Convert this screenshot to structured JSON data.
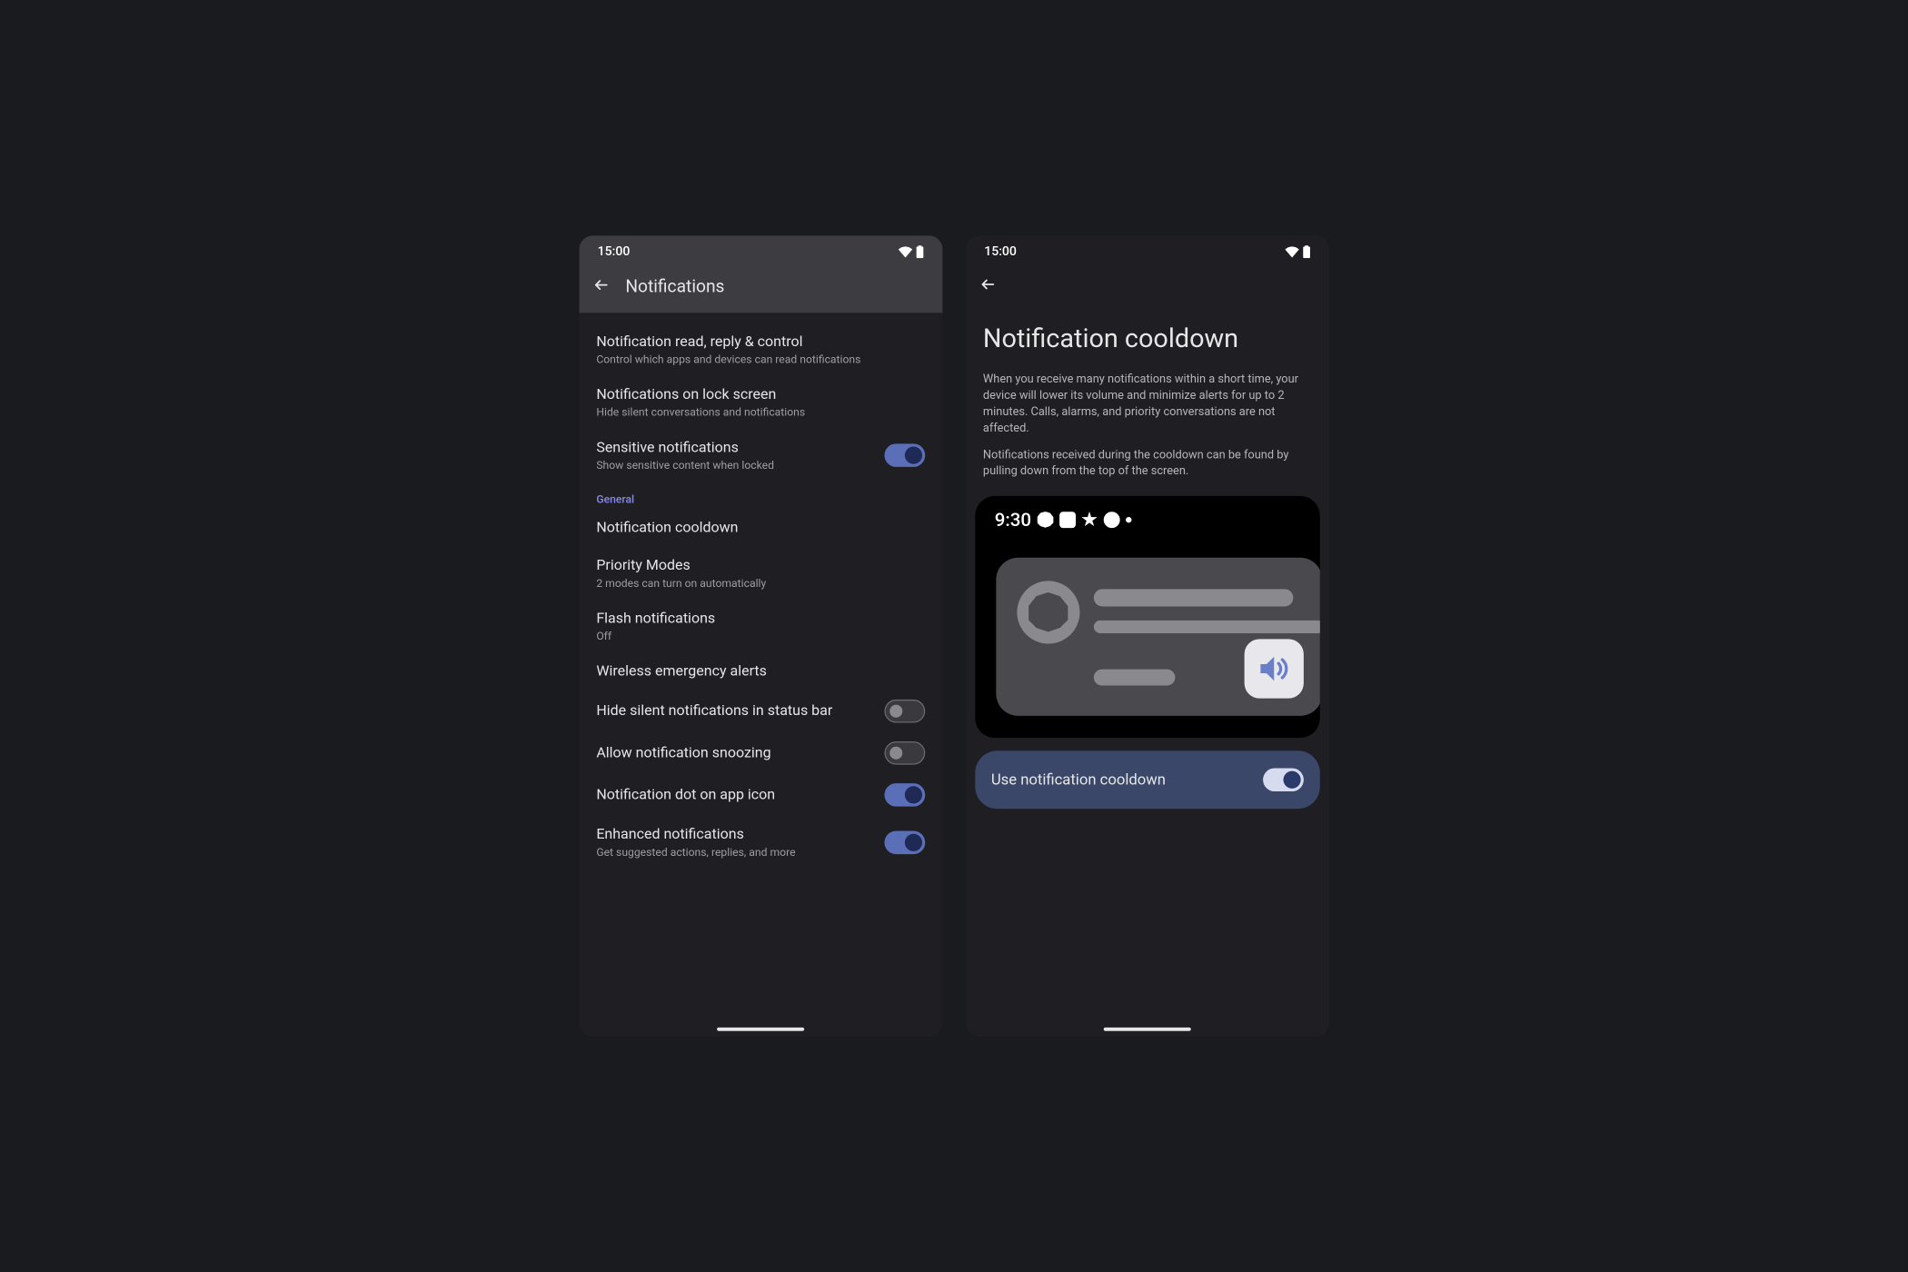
{
  "status": {
    "time": "15:00"
  },
  "left": {
    "appbar_title": "Notifications",
    "items": [
      {
        "title": "Notification read, reply & control",
        "sub": "Control which apps and devices can read notifications",
        "toggle": null
      },
      {
        "title": "Notifications on lock screen",
        "sub": "Hide silent conversations and notifications",
        "toggle": null
      },
      {
        "title": "Sensitive notifications",
        "sub": "Show sensitive content when locked",
        "toggle": true
      }
    ],
    "section_header": "General",
    "general_items": [
      {
        "title": "Notification cooldown",
        "sub": "",
        "toggle": null
      },
      {
        "title": "Priority Modes",
        "sub": "2 modes can turn on automatically",
        "toggle": null
      },
      {
        "title": "Flash notifications",
        "sub": "Off",
        "toggle": null
      },
      {
        "title": "Wireless emergency alerts",
        "sub": "",
        "toggle": null
      },
      {
        "title": "Hide silent notifications in status bar",
        "sub": "",
        "toggle": false
      },
      {
        "title": "Allow notification snoozing",
        "sub": "",
        "toggle": false
      },
      {
        "title": "Notification dot on app icon",
        "sub": "",
        "toggle": true
      },
      {
        "title": "Enhanced notifications",
        "sub": "Get suggested actions, replies, and more",
        "toggle": true
      }
    ]
  },
  "right": {
    "page_title": "Notification cooldown",
    "desc1": "When you receive many notifications within a short time, your device will lower its volume and minimize alerts for up to 2 minutes. Calls, alarms, and priority conversations are not affected.",
    "desc2": "Notifications received during the cooldown can be found by pulling down from the top of the screen.",
    "preview_time": "9:30",
    "primary_toggle_label": "Use notification cooldown",
    "primary_toggle_on": true
  }
}
